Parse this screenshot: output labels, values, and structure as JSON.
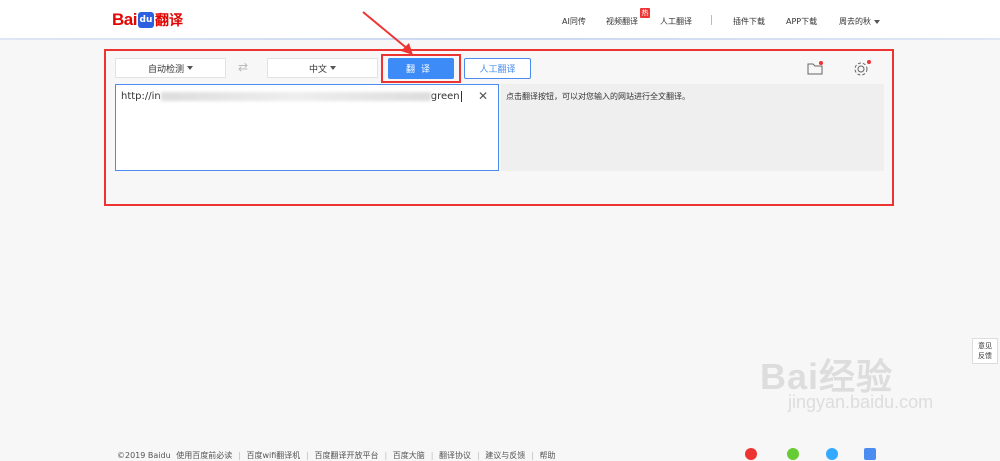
{
  "header": {
    "logo": {
      "bai": "Bai",
      "du": "du",
      "fanyi": "翻译"
    },
    "nav": [
      "AI同传",
      "视频翻译",
      "人工翻译",
      "插件下载",
      "APP下载",
      "周去的秋"
    ],
    "hot_badge": "热"
  },
  "toolbar": {
    "source_lang": "自动检测",
    "target_lang": "中文",
    "translate_label": "翻译",
    "human_translate_label": "人工翻译",
    "icons": [
      "star-folder-icon",
      "gear-icon"
    ]
  },
  "input": {
    "prefix": "http://in",
    "suffix": "green"
  },
  "output": {
    "hint": "点击翻译按钮，可以对您输入的网站进行全文翻译。"
  },
  "feedback": {
    "line1": "意见",
    "line2": "反馈"
  },
  "watermark": {
    "big": "Bai经验",
    "small": "jingyan.baidu.com"
  },
  "footer": {
    "copyright": "©2019 Baidu",
    "links": [
      "使用百度前必读",
      "百度wifi翻译机",
      "百度翻译开放平台",
      "百度大脑",
      "翻译协议",
      "建议与反馈",
      "帮助"
    ]
  },
  "colors": {
    "accent": "#3c8bf7",
    "annotation": "#e33333",
    "brand_red": "#e10601"
  }
}
